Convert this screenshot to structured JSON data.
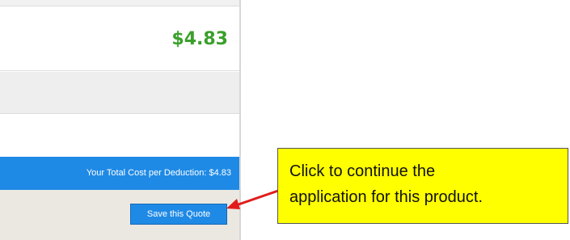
{
  "quote": {
    "price": "$4.83",
    "total_label": "Your Total Cost per Deduction: $4.83",
    "save_label": "Save this Quote"
  },
  "annotation": {
    "line1": "Click to continue the",
    "line2": "application for this product.",
    "background_color": "#ffff00",
    "arrow_color": "#e11b1b"
  },
  "colors": {
    "price": "#3aa02b",
    "accent": "#1f8ae6",
    "footer_bg": "#ebe8e1"
  }
}
